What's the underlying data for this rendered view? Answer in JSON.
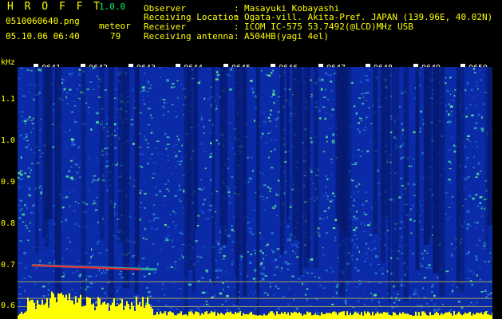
{
  "header": {
    "app_name": "H R O F F T",
    "version": "1.0.0",
    "filename": "0510060640.png",
    "datetime": "05.10.06 06:40",
    "meteor_label": "meteor",
    "meteor_count": "79"
  },
  "station": {
    "rows": [
      {
        "label": "Observer",
        "sep": ":",
        "value": "Masayuki Kobayashi"
      },
      {
        "label": "Receiving Location",
        "sep": ":",
        "value": "Ogata-vill. Akita-Pref. JAPAN (139.96E, 40.02N)"
      },
      {
        "label": "Receiver",
        "sep": ":",
        "value": "ICOM IC-575 53.7492(@LCD)MHz USB"
      },
      {
        "label": "Receiving antenna",
        "sep": ":",
        "value": "A504HB(yagi 4el)"
      }
    ]
  },
  "chart_data": {
    "type": "heatmap",
    "ylabel": "kHz",
    "y_ticks": [
      "1.1",
      "1.0",
      "0.9",
      "0.8",
      "0.7",
      "0.6"
    ],
    "ylim": [
      0.57,
      1.18
    ],
    "x_ticks": [
      "0641",
      "0642",
      "0643",
      "0644",
      "0645",
      "0646",
      "0647",
      "0648",
      "0649",
      "0650"
    ],
    "xlim": [
      "0640",
      "0650"
    ],
    "meteor_trace": {
      "time_start": "0640.3",
      "time_end": "0642.6",
      "freq_start_khz": 0.7,
      "freq_end_khz": 0.69
    },
    "colors": {
      "background": "#0a2aa8",
      "noise_high": "#38c8a0",
      "meteor": "#ff2030",
      "histogram": "#ffff00",
      "guide_lines": "#a0a060"
    }
  }
}
